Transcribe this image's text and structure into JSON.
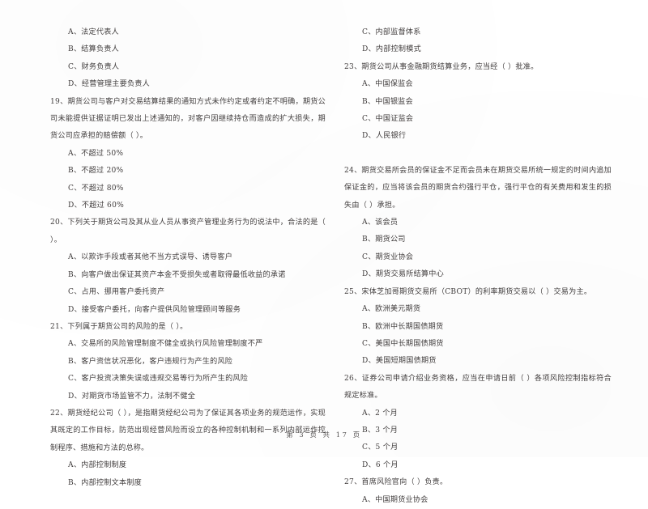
{
  "document": {
    "page_label_prefix": "第",
    "page_number": "3",
    "page_label_middle": "页  共",
    "total_pages": "17",
    "page_label_suffix": "页",
    "footer_text": "第 3 页  共 17 页"
  },
  "left_column": {
    "q18_options": [
      "A、法定代表人",
      "B、结算负责人",
      "C、财务负责人",
      "D、经营管理主要负责人"
    ],
    "q19": {
      "stem": "19、期货公司与客户对交易结算结果的通知方式未作约定或者约定不明确，期货公司未能提供证据证明已发出上述通知的，对客户因继续持仓而造成的扩大损失，期货公司应承担的赔偿额（    ）。",
      "options": [
        "A、不超过 50%",
        "B、不超过 20%",
        "C、不超过 80%",
        "D、不超过 60%"
      ]
    },
    "q20": {
      "stem": "20、下列关于期货公司及其从业人员从事资产管理业务行为的说法中，合法的是（    ）。",
      "options": [
        "A、以欺诈手段或者其他不当方式误导、诱导客户",
        "B、向客户做出保证其资产本金不受损失或者取得最低收益的承诺",
        "C、占用、挪用客户委托资产",
        "D、接受客户委托，向客户提供风险管理顾问等服务"
      ]
    },
    "q21": {
      "stem": "21、下列属于期货公司的风险的是（    ）。",
      "options": [
        "A、交易所的风险管理制度不健全或执行风险管理制度不严",
        "B、客户资信状况恶化，客户违规行为产生的风险",
        "C、客户投资决策失误或违规交易等行为所产生的风险",
        "D、对期货市场监管不力，法制不健全"
      ]
    },
    "q22": {
      "stem": "22、期货经纪公司（    ），是指期货经纪公司为了保证其各项业务的规范运作，实现其既定的工作目标，防范出现经营风险而设立的各种控制机制和一系列内部运作控制程序、措施和方法的总称。",
      "options": [
        "A、内部控制制度",
        "B、内部控制文本制度"
      ]
    }
  },
  "right_column": {
    "q22_options_cont": [
      "C、内部监督体系",
      "D、内部控制模式"
    ],
    "q23": {
      "stem": "23、期货公司从事金融期货结算业务，应当经（    ）批准。",
      "options": [
        "A、中国保监会",
        "B、中国银监会",
        "C、中国证监会",
        "D、人民银行"
      ]
    },
    "q24": {
      "stem": "24、期货交易所会员的保证金不足而会员未在期货交易所统一规定的时间内追加保证金的，应当将该会员的期货合约强行平仓，强行平仓的有关费用和发生的损失由（    ）承担。",
      "options": [
        "A、该会员",
        "B、期货公司",
        "C、期货业协会",
        "D、期货交易所结算中心"
      ]
    },
    "q25": {
      "stem": "25、宋体芝加哥期货交易所（CBOT）的利率期货交易以（    ）交易为主。",
      "options": [
        "A、欧洲美元期货",
        "B、欧洲中长期国债期货",
        "C、美国中长期国债期货",
        "D、美国短期国债期货"
      ]
    },
    "q26": {
      "stem": "26、证券公司申请介绍业务资格，应当在申请日前（    ）各项风险控制指标符合规定标准。",
      "options": [
        "A、2 个月",
        "B、3 个月",
        "C、5 个月",
        "D、6 个月"
      ]
    },
    "q27": {
      "stem": "27、首席风险官向（    ）负责。",
      "options": [
        "A、中国期货业协会"
      ]
    }
  }
}
